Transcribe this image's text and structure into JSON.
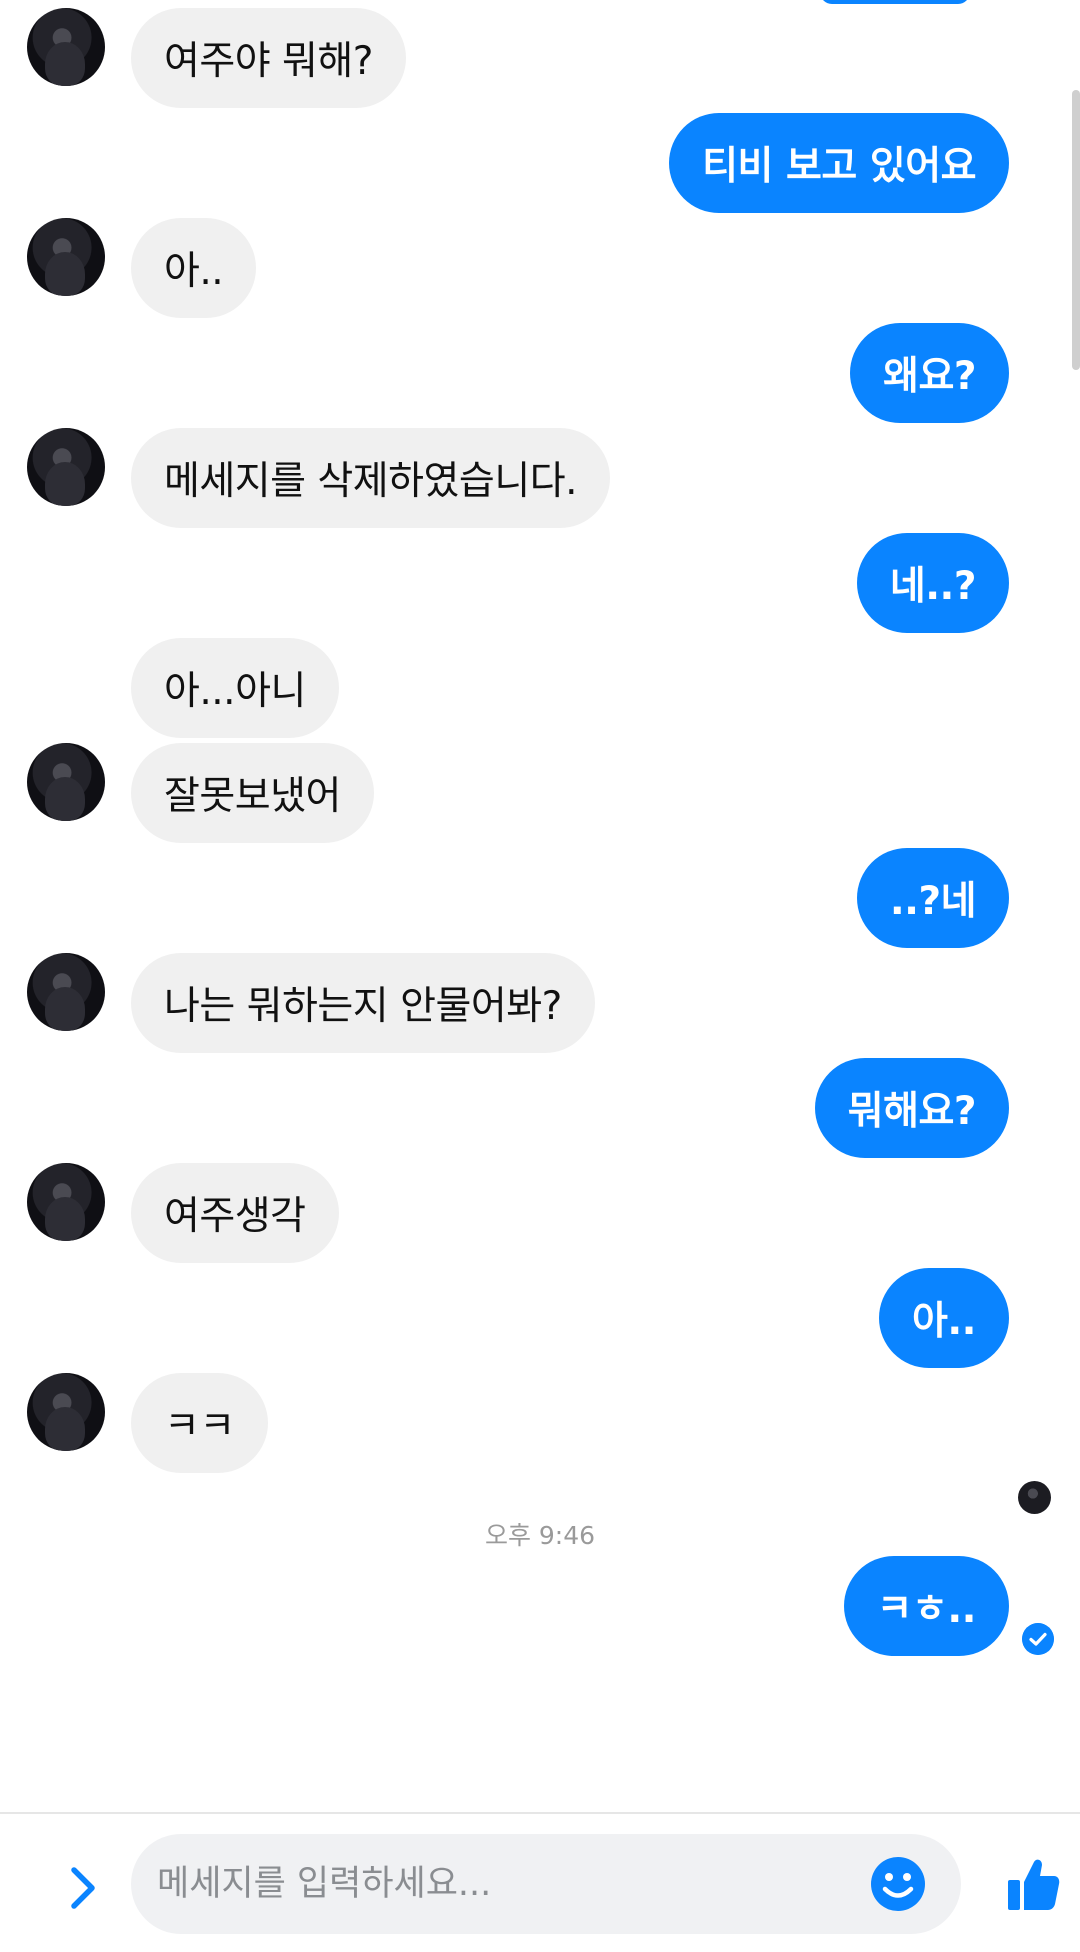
{
  "conversation": {
    "messages": [
      {
        "side": "in",
        "text": "여주야 뭐해?",
        "avatar": true
      },
      {
        "side": "out",
        "text": "티비 보고 있어요"
      },
      {
        "side": "in",
        "text": "아..",
        "avatar": true
      },
      {
        "side": "out",
        "text": "왜요?"
      },
      {
        "side": "in",
        "text": "메세지를 삭제하였습니다.",
        "avatar": true
      },
      {
        "side": "out",
        "text": "네..?"
      },
      {
        "side": "in",
        "text": "아...아니",
        "avatar": false
      },
      {
        "side": "in",
        "text": "잘못보냈어",
        "avatar": true
      },
      {
        "side": "out",
        "text": "..?네"
      },
      {
        "side": "in",
        "text": "나는 뭐하는지 안물어봐?",
        "avatar": true
      },
      {
        "side": "out",
        "text": "뭐해요?"
      },
      {
        "side": "in",
        "text": "여주생각",
        "avatar": true
      },
      {
        "side": "out",
        "text": "아.."
      },
      {
        "side": "in",
        "text": "ㅋㅋ",
        "avatar": true
      },
      {
        "side": "out",
        "text": "ㅋㅎ.."
      }
    ],
    "timestamp": "오후 9:46",
    "last_message_status": "seen"
  },
  "composer": {
    "placeholder": "메세지를 입력하세요..."
  },
  "icons": {
    "expand": "chevron-right-icon",
    "emoji": "smiley-icon",
    "like": "thumbs-up-icon",
    "seen": "check-circle-icon"
  },
  "colors": {
    "accent": "#0a84ff",
    "incoming_bubble": "#f0f0f0",
    "outgoing_text": "#ffffff"
  }
}
